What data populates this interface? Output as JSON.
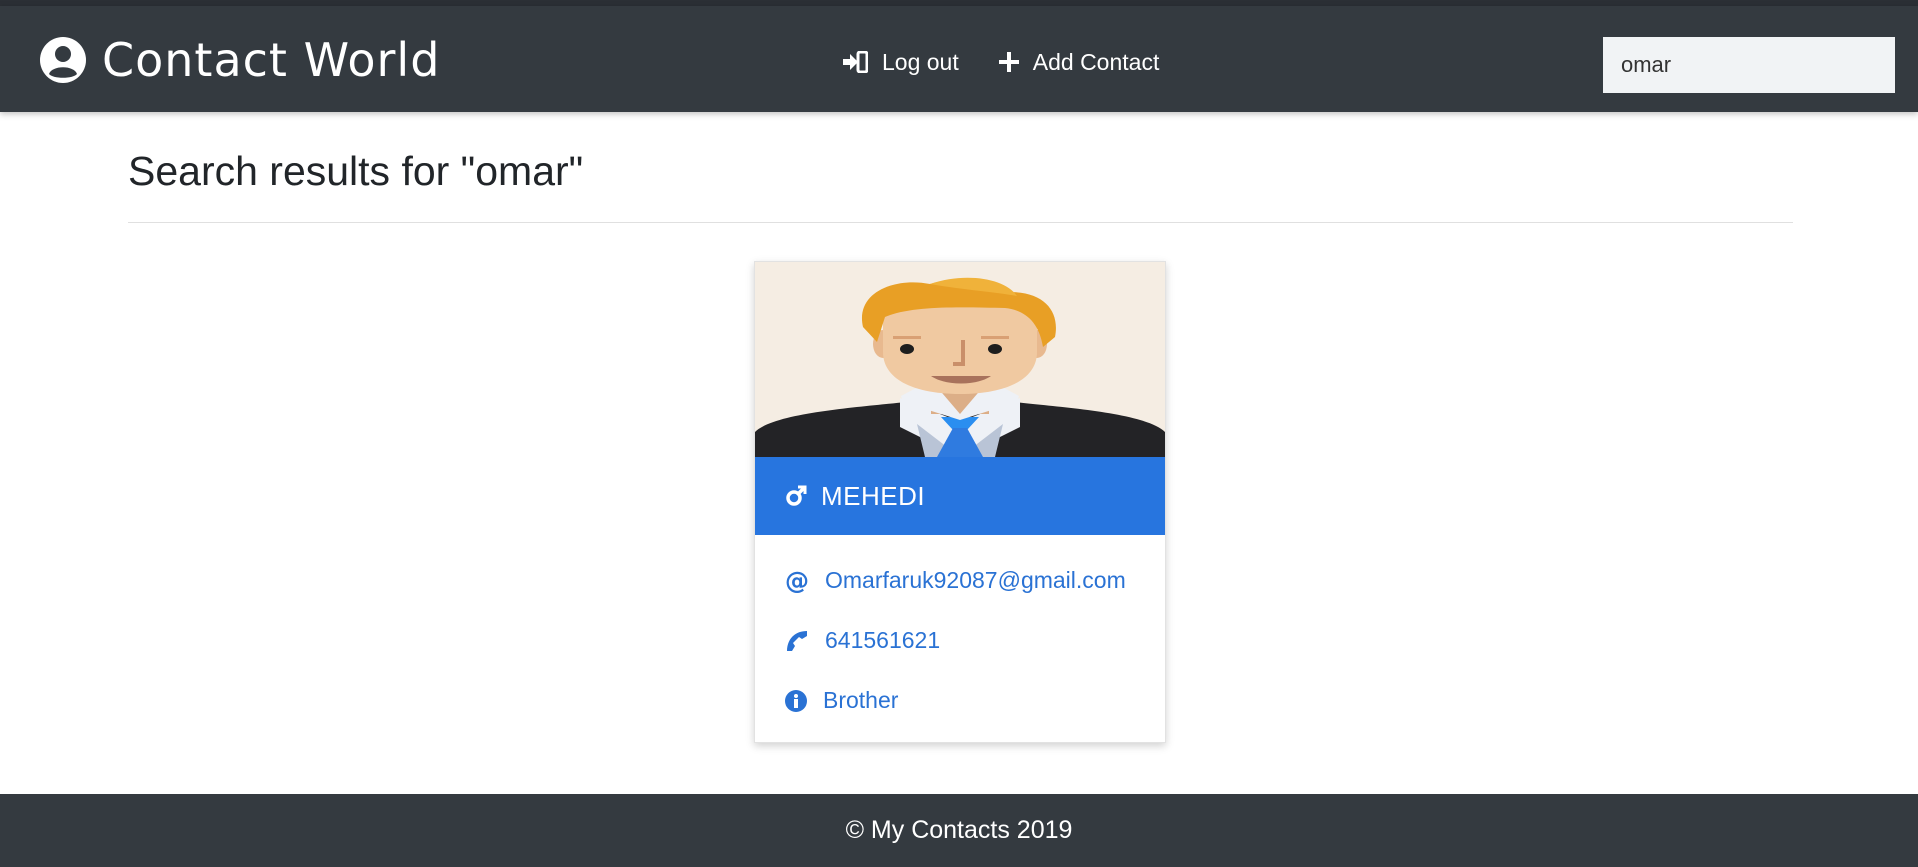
{
  "navbar": {
    "brand": "Contact World",
    "logout_label": "Log out",
    "add_contact_label": "Add Contact",
    "search_value": "omar",
    "colors": {
      "background": "#343a40",
      "text": "#ffffff"
    }
  },
  "page": {
    "title": "Search results for \"omar\""
  },
  "contact": {
    "name": "MEHEDI",
    "gender_icon": "male-symbol-icon",
    "email": "Omarfaruk92087@gmail.com",
    "phone": "641561621",
    "relation": "Brother",
    "accent_color": "#2775df"
  },
  "footer": {
    "text": "© My Contacts 2019"
  }
}
